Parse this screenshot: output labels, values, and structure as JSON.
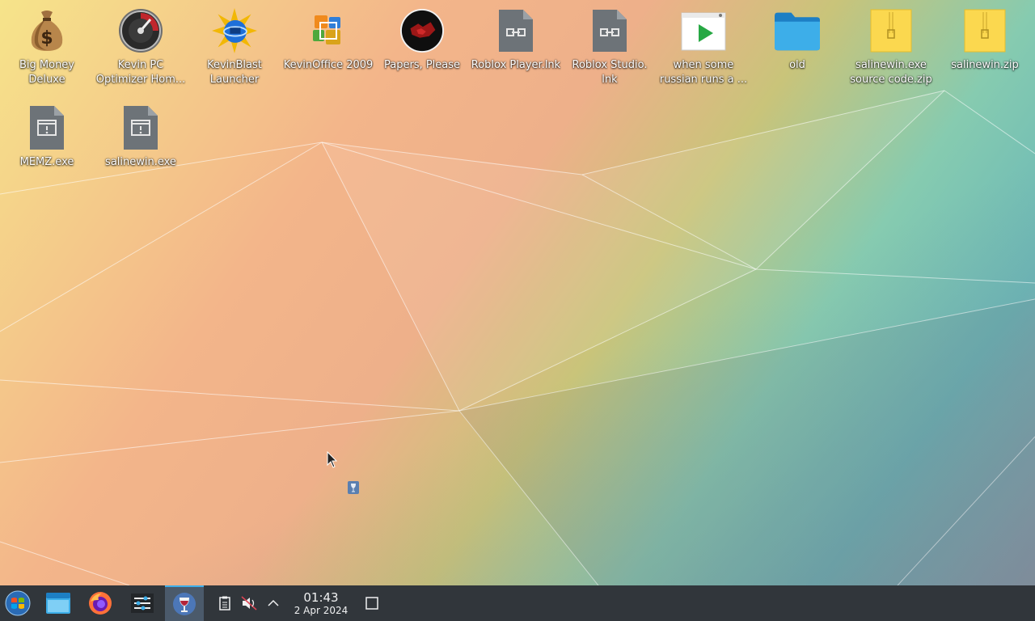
{
  "desktop": {
    "icons": [
      {
        "label": "Big Money\nDeluxe",
        "icon": "money-bag-icon"
      },
      {
        "label": "Kevin PC\nOptimizer Hom...",
        "icon": "speedometer-icon"
      },
      {
        "label": "KevinBlast\nLauncher",
        "icon": "globe-burst-icon"
      },
      {
        "label": "KevinOffice 2009",
        "icon": "office-logo-icon"
      },
      {
        "label": "Papers, Please",
        "icon": "papers-please-icon"
      },
      {
        "label": "Roblox Player.lnk",
        "icon": "shortcut-file-icon"
      },
      {
        "label": "Roblox Studio.\nlnk",
        "icon": "shortcut-file-icon"
      },
      {
        "label": "when some\nrussian runs a ...",
        "icon": "video-file-icon"
      },
      {
        "label": "old",
        "icon": "folder-icon"
      },
      {
        "label": "salinewin.exe\nsource code.zip",
        "icon": "zip-archive-icon"
      },
      {
        "label": "salinewin.zip",
        "icon": "zip-archive-icon"
      },
      {
        "label": "MEMZ.exe",
        "icon": "executable-file-icon"
      },
      {
        "label": "salinewin.exe",
        "icon": "executable-file-icon"
      }
    ]
  },
  "taskbar": {
    "apps": [
      {
        "name": "start-menu-button",
        "icon": "windows-orb-icon"
      },
      {
        "name": "file-manager-button",
        "icon": "folder-window-icon"
      },
      {
        "name": "firefox-button",
        "icon": "firefox-icon"
      },
      {
        "name": "settings-button",
        "icon": "sliders-icon"
      },
      {
        "name": "wine-button",
        "icon": "wine-glass-icon"
      }
    ],
    "tray": {
      "clipboard": "clipboard-icon",
      "volume": "volume-muted-icon",
      "expand": "chevron-up-icon"
    },
    "clock": {
      "time": "01:43",
      "date": "2 Apr 2024"
    },
    "show_desktop": "show-desktop-icon"
  },
  "colors": {
    "taskbar_bg": "#31363b",
    "active_task_bg": "#4b5a6b",
    "accent": "#3daee9",
    "folder_blue": "#3daee9",
    "zip_yellow": "#fbd84f"
  }
}
